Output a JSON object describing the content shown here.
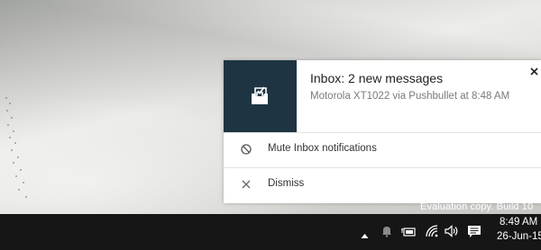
{
  "notification": {
    "app_icon": "inbox-app-icon",
    "accent_color": "#1e3442",
    "title": "Inbox: 2 new messages",
    "subtitle": "Motorola XT1022 via Pushbullet at 8:48 AM",
    "close_icon": "close-icon",
    "actions": [
      {
        "icon": "block-icon",
        "label": "Mute Inbox notifications"
      },
      {
        "icon": "close-icon",
        "label": "Dismiss"
      }
    ]
  },
  "watermark": "Evaluation copy. Build 10",
  "taskbar": {
    "tray_icons": [
      "chevron-up-icon",
      "notification-bell-icon",
      "battery-icon",
      "wifi-icon",
      "volume-icon",
      "action-center-icon"
    ],
    "time": "8:49 AM",
    "date": "26-Jun-15"
  }
}
